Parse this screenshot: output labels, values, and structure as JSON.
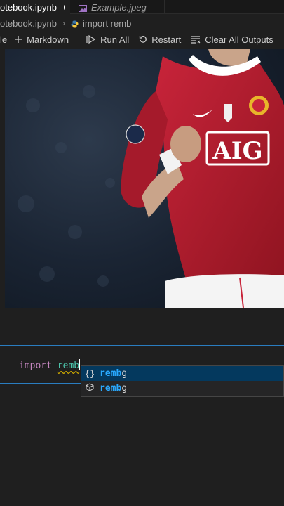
{
  "tabs": [
    {
      "label": "otebook.ipynb",
      "active": true,
      "modified": true
    },
    {
      "label": "Example.jpeg",
      "active": false
    }
  ],
  "breadcrumb": {
    "file": "otebook.ipynb",
    "cell": "import remb"
  },
  "toolbar": {
    "partial": "le",
    "markdown": "Markdown",
    "run_all": "Run All",
    "restart": "Restart",
    "clear_outputs": "Clear All Outputs"
  },
  "image": {
    "sponsor_text": "AIG",
    "description_colors": {
      "shirt": "#b51f2e",
      "background": "#1e2a3a"
    }
  },
  "cell": {
    "keyword": "import",
    "typed": "remb"
  },
  "suggestions": [
    {
      "icon": "braces-icon",
      "match": "remb",
      "rest": "g"
    },
    {
      "icon": "module-cube-icon",
      "match": "remb",
      "rest": "g"
    }
  ],
  "colors": {
    "accent": "#2a7dc0",
    "selected_row": "#04395e",
    "match_highlight": "#2aaaff"
  }
}
